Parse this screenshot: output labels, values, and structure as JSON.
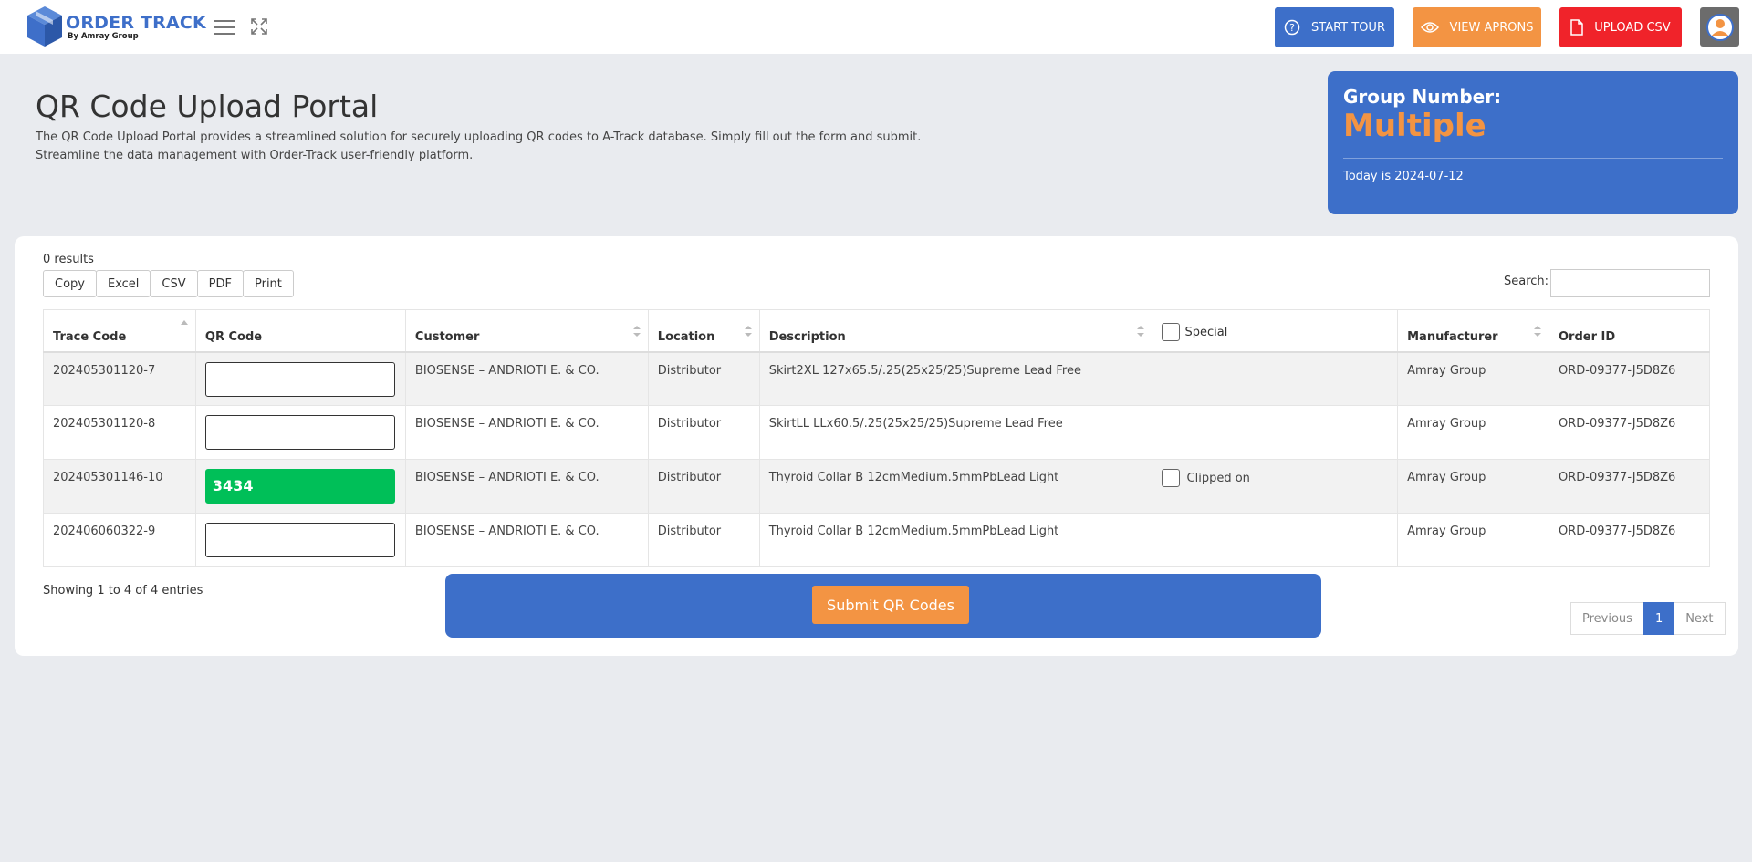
{
  "header": {
    "logo_title": "ORDER TRACK",
    "logo_sub": "By Amray Group",
    "buttons": {
      "tour": "START TOUR",
      "aprons": "VIEW APRONS",
      "csv": "UPLOAD CSV"
    },
    "icons": [
      "box-logo-icon",
      "hamburger-icon",
      "expand-icon",
      "question-circle-icon",
      "eye-icon",
      "file-icon",
      "user-avatar-icon"
    ]
  },
  "page": {
    "title": "QR Code Upload Portal",
    "description_1": "The QR Code Upload Portal provides a streamlined solution for securely uploading QR codes to A-Track database. Simply fill out the form and submit.",
    "description_2": "Streamline the data management with Order-Track user-friendly platform."
  },
  "group_card": {
    "label": "Group Number:",
    "value": "Multiple",
    "date": "Today is 2024-07-12"
  },
  "table_tools": {
    "results": "0 results",
    "export_buttons": [
      "Copy",
      "Excel",
      "CSV",
      "PDF",
      "Print"
    ],
    "search_label": "Search:"
  },
  "table": {
    "columns": [
      "Trace Code",
      "QR Code",
      "Customer",
      "Location",
      "Description",
      "Special",
      "Manufacturer",
      "Order ID"
    ],
    "rows": [
      {
        "trace": "202405301120-7",
        "qr": "",
        "customer": "BIOSENSE – ANDRIOTI E. & CO.",
        "location": "Distributor",
        "description": "Skirt2XL 127x65.5/.25(25x25/25)Supreme Lead Free",
        "special": "",
        "manufacturer": "Amray Group",
        "order": "ORD-09377-J5D8Z6"
      },
      {
        "trace": "202405301120-8",
        "qr": "",
        "customer": "BIOSENSE – ANDRIOTI E. & CO.",
        "location": "Distributor",
        "description": "SkirtLL LLx60.5/.25(25x25/25)Supreme Lead Free",
        "special": "",
        "manufacturer": "Amray Group",
        "order": "ORD-09377-J5D8Z6"
      },
      {
        "trace": "202405301146-10",
        "qr": "3434",
        "customer": "BIOSENSE – ANDRIOTI E. & CO.",
        "location": "Distributor",
        "description": "Thyroid Collar B 12cmMedium.5mmPbLead Light",
        "special": "Clipped on",
        "manufacturer": "Amray Group",
        "order": "ORD-09377-J5D8Z6"
      },
      {
        "trace": "202406060322-9",
        "qr": "",
        "customer": "BIOSENSE – ANDRIOTI E. & CO.",
        "location": "Distributor",
        "description": "Thyroid Collar B 12cmMedium.5mmPbLead Light",
        "special": "",
        "manufacturer": "Amray Group",
        "order": "ORD-09377-J5D8Z6"
      }
    ]
  },
  "footer": {
    "showing": "Showing 1 to 4 of 4 entries",
    "submit": "Submit QR Codes",
    "pager": {
      "previous": "Previous",
      "current": "1",
      "next": "Next"
    }
  },
  "colors": {
    "primary": "#3d6fc9",
    "orange": "#f39443",
    "red": "#f0232a",
    "green": "#00bf58",
    "background": "#e9ebef"
  }
}
